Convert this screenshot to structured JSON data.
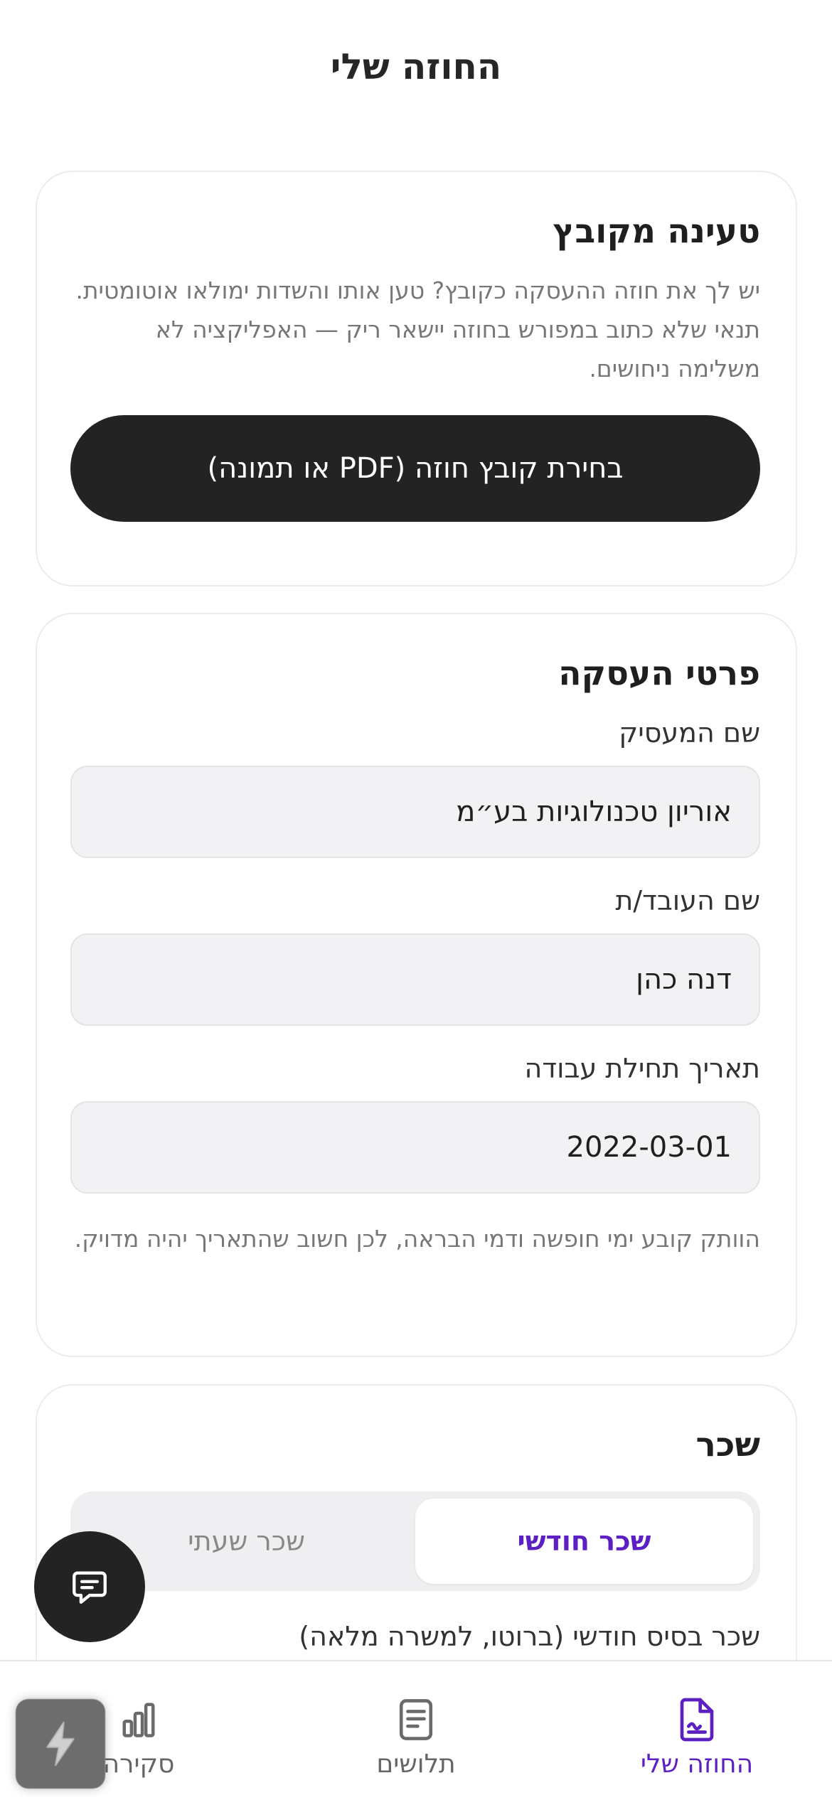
{
  "header": {
    "title": "החוזה שלי"
  },
  "upload": {
    "title": "טעינה מקובץ",
    "description": "יש לך את חוזה ההעסקה כקובץ? טען אותו והשדות ימולאו אוטומטית. תנאי שלא כתוב במפורש בחוזה יישאר ריק — האפליקציה לא משלימה ניחושים.",
    "button_label": "בחירת קובץ חוזה (PDF או תמונה)"
  },
  "details": {
    "title": "פרטי העסקה",
    "employer_label": "שם המעסיק",
    "employer_value": "אוריון טכנולוגיות בע״מ",
    "employee_label": "שם העובד/ת",
    "employee_value": "דנה כהן",
    "start_date_label": "תאריך תחילת עבודה",
    "start_date_value": "2022-03-01",
    "hint": "הוותק קובע ימי חופשה ודמי הבראה, לכן חשוב שהתאריך יהיה מדויק."
  },
  "salary": {
    "title": "שכר",
    "tabs": [
      {
        "label": "שכר חודשי",
        "active": true
      },
      {
        "label": "שכר שעתי",
        "active": false
      }
    ],
    "base_label": "שכר בסיס חודשי (ברוטו, למשרה מלאה)"
  },
  "tabbar": {
    "items": [
      {
        "label": "החוזה שלי",
        "icon": "contract-document-icon",
        "active": true
      },
      {
        "label": "תלושים",
        "icon": "payslip-document-icon",
        "active": false
      },
      {
        "label": "סקירה",
        "icon": "bar-chart-icon",
        "active": false
      }
    ]
  },
  "fab": {
    "icon": "chat-bubble-icon"
  },
  "overlay": {
    "icon": "lightning-icon"
  },
  "colors": {
    "accent": "#5b1fc2",
    "dark": "#232323",
    "input_bg": "#f2f2f4",
    "muted_text": "#777777"
  }
}
